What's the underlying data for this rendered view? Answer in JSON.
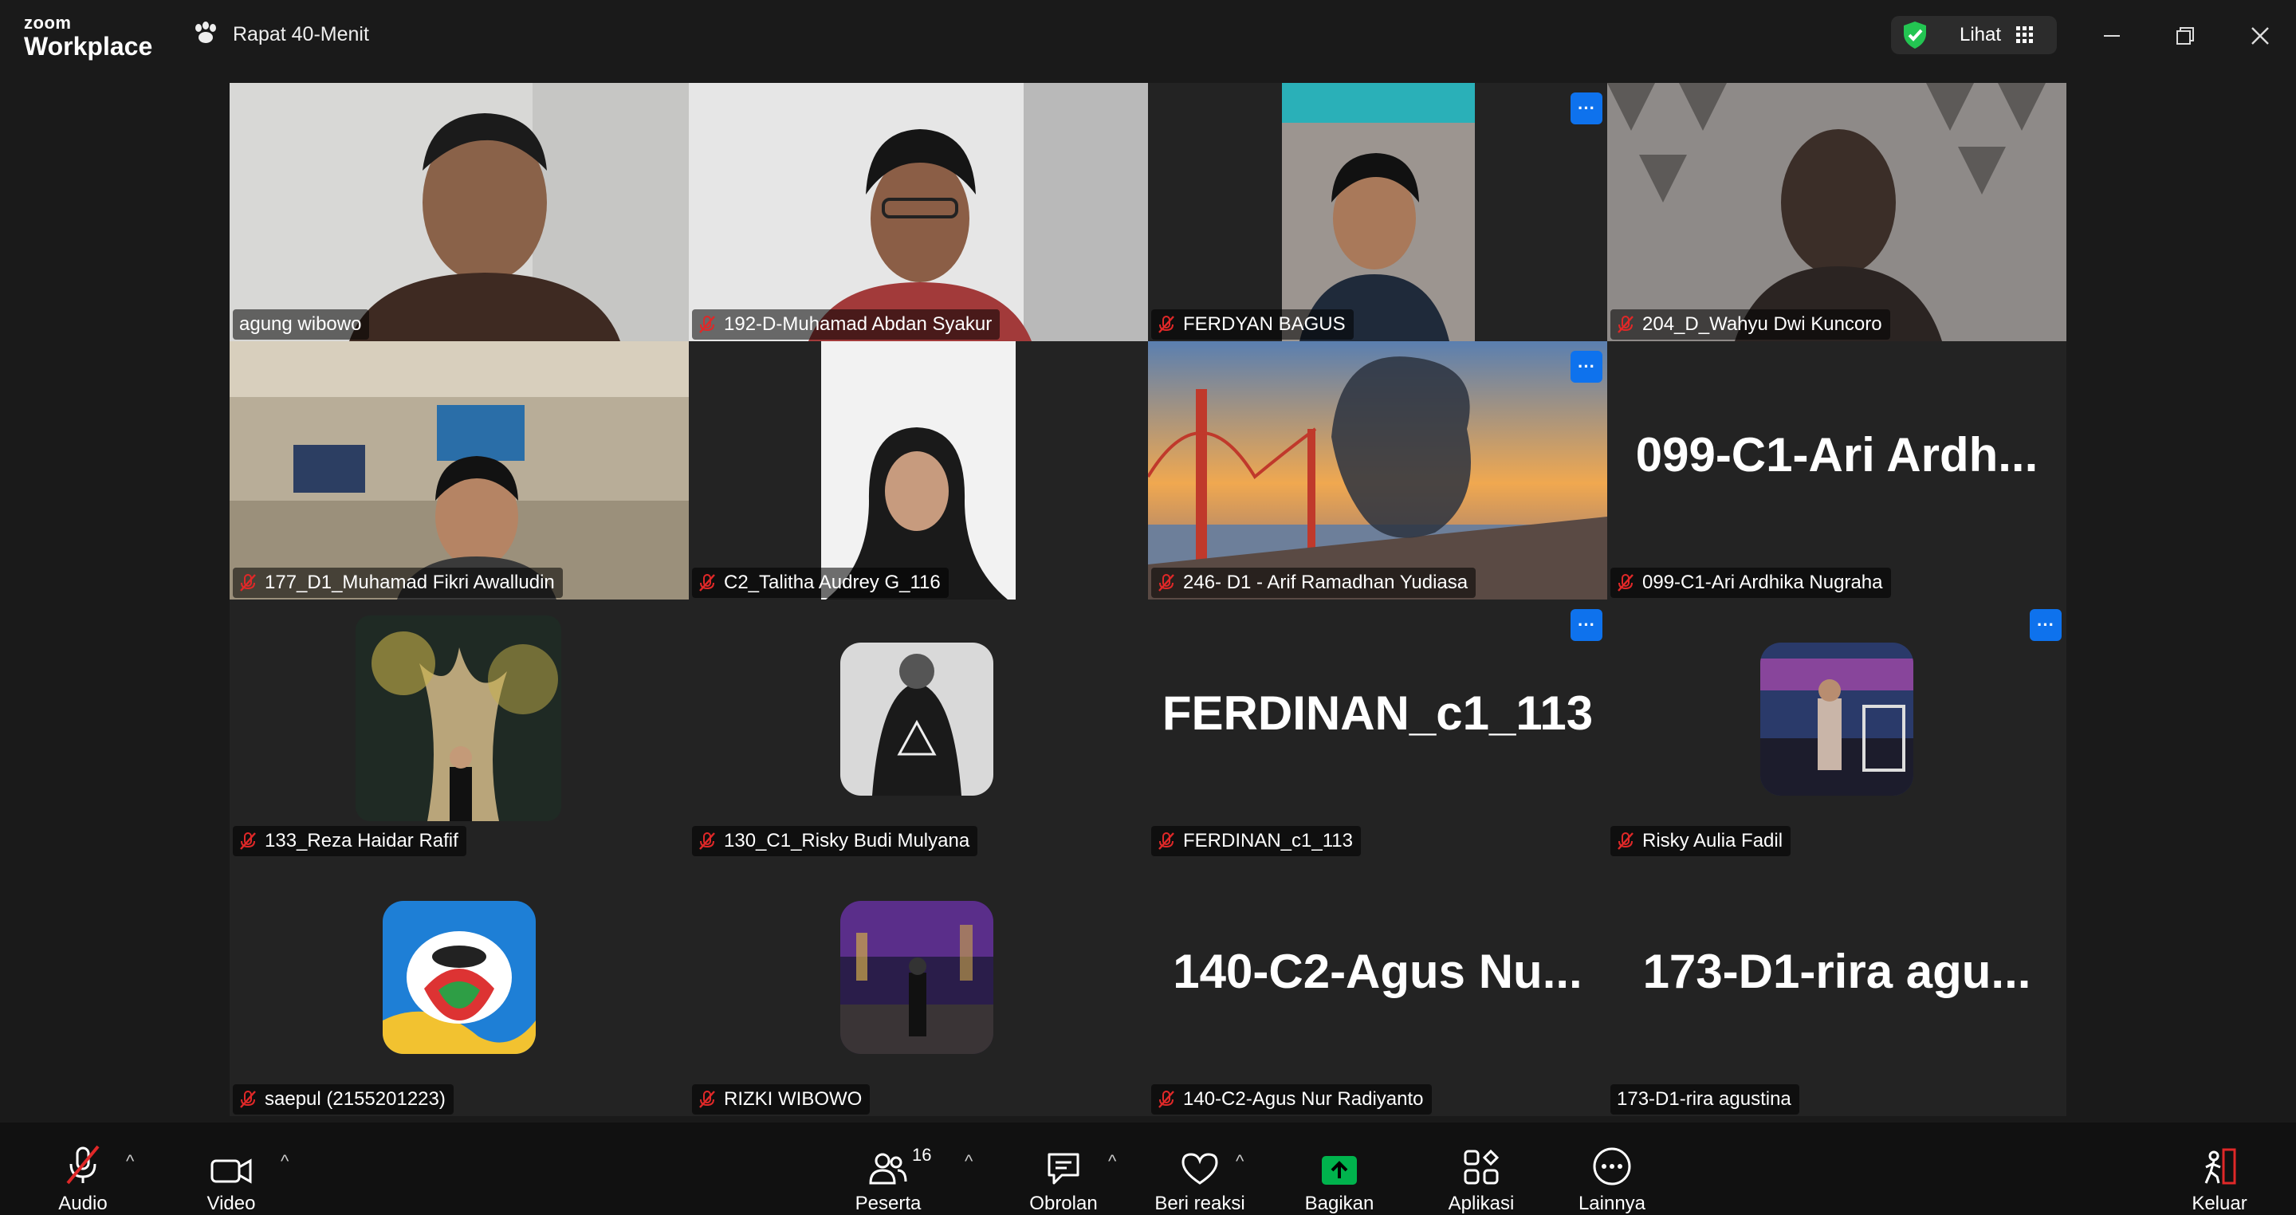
{
  "app": {
    "logo_top": "zoom",
    "logo_bottom": "Workplace"
  },
  "meeting": {
    "title": "Rapat 40-Menit"
  },
  "view": {
    "label": "Lihat"
  },
  "colors": {
    "active_border": "#23d18b",
    "accent": "#0e72ed",
    "mic_muted": "#e02828",
    "share_green": "#00b34d"
  },
  "tiles": [
    {
      "name": "agung wibowo",
      "muted": false,
      "active": true
    },
    {
      "name": "192-D-Muhamad Abdan Syakur",
      "muted": true
    },
    {
      "name": "FERDYAN BAGUS",
      "muted": true
    },
    {
      "name": "204_D_Wahyu Dwi Kuncoro",
      "muted": true
    },
    {
      "name": "177_D1_Muhamad Fikri Awalludin",
      "muted": true
    },
    {
      "name": "C2_Talitha Audrey G_116",
      "muted": true
    },
    {
      "name": "246- D1 - Arif Ramadhan Yudiasa",
      "muted": true
    },
    {
      "name": "099-C1-Ari Ardhika Nugraha",
      "display": "099-C1-Ari  Ardh...",
      "muted": true
    },
    {
      "name": "133_Reza Haidar Rafif",
      "muted": true
    },
    {
      "name": "130_C1_Risky Budi Mulyana",
      "muted": true
    },
    {
      "name": "FERDINAN_c1_113",
      "display": "FERDINAN_c1_113",
      "muted": true
    },
    {
      "name": "Risky Aulia Fadil",
      "muted": true
    },
    {
      "name": "saepul (2155201223)",
      "muted": true
    },
    {
      "name": "RIZKI WIBOWO",
      "muted": true
    },
    {
      "name": "140-C2-Agus Nur Radiyanto",
      "display": "140-C2-Agus  Nu...",
      "muted": true
    },
    {
      "name": "173-D1-rira agustina",
      "display": "173-D1-rira  agu...",
      "muted": false
    }
  ],
  "more_button": "···",
  "toolbar": {
    "audio": "Audio",
    "video": "Video",
    "participants": "Peserta",
    "participants_count": "16",
    "chat": "Obrolan",
    "react": "Beri reaksi",
    "share": "Bagikan",
    "apps": "Aplikasi",
    "more": "Lainnya",
    "leave": "Keluar"
  }
}
